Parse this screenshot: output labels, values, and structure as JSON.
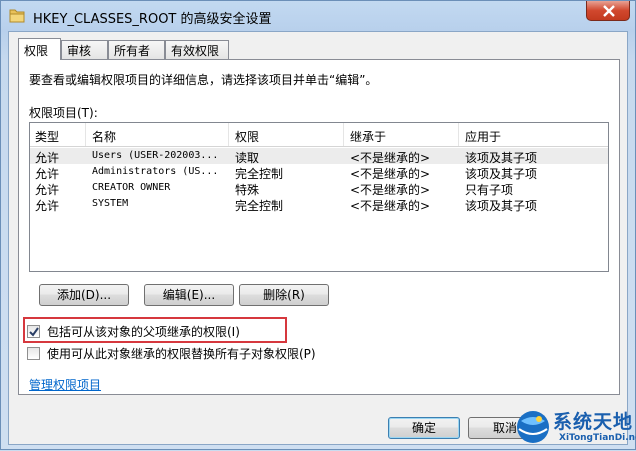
{
  "window": {
    "title": "HKEY_CLASSES_ROOT 的高级安全设置"
  },
  "tabs": [
    {
      "label": "权限",
      "active": true
    },
    {
      "label": "审核",
      "active": false
    },
    {
      "label": "所有者",
      "active": false
    },
    {
      "label": "有效权限",
      "active": false
    }
  ],
  "panel": {
    "description": "要查看或编辑权限项目的详细信息，请选择该项目并单击“编辑”。",
    "list_label": "权限项目(T):"
  },
  "table": {
    "columns": [
      "类型",
      "名称",
      "权限",
      "继承于",
      "应用于"
    ],
    "rows": [
      [
        "允许",
        "Users (USER-202003...",
        "读取",
        "<不是继承的>",
        "该项及其子项"
      ],
      [
        "允许",
        "Administrators (US...",
        "完全控制",
        "<不是继承的>",
        "该项及其子项"
      ],
      [
        "允许",
        "CREATOR OWNER",
        "特殊",
        "<不是继承的>",
        "只有子项"
      ],
      [
        "允许",
        "SYSTEM",
        "完全控制",
        "<不是继承的>",
        "该项及其子项"
      ]
    ]
  },
  "buttons": {
    "add": "添加(D)...",
    "edit": "编辑(E)...",
    "remove": "删除(R)",
    "ok": "确定",
    "cancel": "取消"
  },
  "checkboxes": {
    "inherit_label": "包括可从该对象的父项继承的权限(I)",
    "inherit_checked": true,
    "replace_label": "使用可从此对象继承的权限替换所有子对象权限(P)",
    "replace_checked": false
  },
  "link": {
    "manage": "管理权限项目"
  },
  "watermark": {
    "text": "系统天地",
    "sub": "XiTongTianDi.net"
  },
  "colors": {
    "highlight": "#d6383e",
    "link": "#0066cc"
  }
}
